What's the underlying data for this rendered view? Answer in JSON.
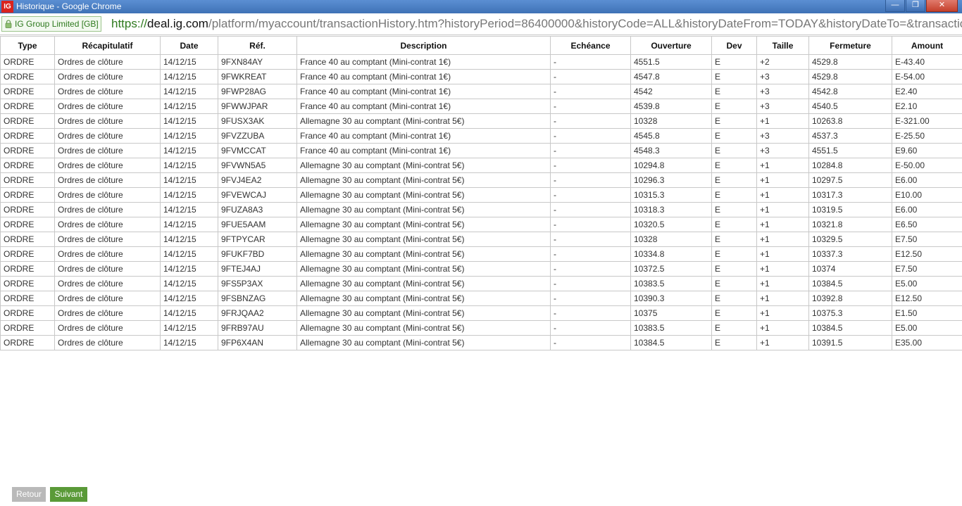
{
  "window": {
    "app_icon": "IG",
    "title": "Historique - Google Chrome"
  },
  "address": {
    "cert_label": "IG Group Limited [GB]",
    "scheme": "https://",
    "host": "deal.ig.com",
    "path": "/platform/myaccount/transactionHistory.htm?historyPeriod=86400000&historyCode=ALL&historyDateFrom=TODAY&historyDateTo=&transactionHisto"
  },
  "table": {
    "headers": [
      "Type",
      "Récapitulatif",
      "Date",
      "Réf.",
      "Description",
      "Echéance",
      "Ouverture",
      "Dev",
      "Taille",
      "Fermeture",
      "Amount"
    ],
    "rows": [
      [
        "ORDRE",
        "Ordres de clôture",
        "14/12/15",
        "9FXN84AY",
        "France 40 au comptant (Mini-contrat 1€)",
        "-",
        "4551.5",
        "E",
        "+2",
        "4529.8",
        "E-43.40"
      ],
      [
        "ORDRE",
        "Ordres de clôture",
        "14/12/15",
        "9FWKREAT",
        "France 40 au comptant (Mini-contrat 1€)",
        "-",
        "4547.8",
        "E",
        "+3",
        "4529.8",
        "E-54.00"
      ],
      [
        "ORDRE",
        "Ordres de clôture",
        "14/12/15",
        "9FWP28AG",
        "France 40 au comptant (Mini-contrat 1€)",
        "-",
        "4542",
        "E",
        "+3",
        "4542.8",
        "E2.40"
      ],
      [
        "ORDRE",
        "Ordres de clôture",
        "14/12/15",
        "9FWWJPAR",
        "France 40 au comptant (Mini-contrat 1€)",
        "-",
        "4539.8",
        "E",
        "+3",
        "4540.5",
        "E2.10"
      ],
      [
        "ORDRE",
        "Ordres de clôture",
        "14/12/15",
        "9FUSX3AK",
        "Allemagne 30 au comptant (Mini-contrat 5€)",
        "-",
        "10328",
        "E",
        "+1",
        "10263.8",
        "E-321.00"
      ],
      [
        "ORDRE",
        "Ordres de clôture",
        "14/12/15",
        "9FVZZUBA",
        "France 40 au comptant (Mini-contrat 1€)",
        "-",
        "4545.8",
        "E",
        "+3",
        "4537.3",
        "E-25.50"
      ],
      [
        "ORDRE",
        "Ordres de clôture",
        "14/12/15",
        "9FVMCCAT",
        "France 40 au comptant (Mini-contrat 1€)",
        "-",
        "4548.3",
        "E",
        "+3",
        "4551.5",
        "E9.60"
      ],
      [
        "ORDRE",
        "Ordres de clôture",
        "14/12/15",
        "9FVWN5A5",
        "Allemagne 30 au comptant (Mini-contrat 5€)",
        "-",
        "10294.8",
        "E",
        "+1",
        "10284.8",
        "E-50.00"
      ],
      [
        "ORDRE",
        "Ordres de clôture",
        "14/12/15",
        "9FVJ4EA2",
        "Allemagne 30 au comptant (Mini-contrat 5€)",
        "-",
        "10296.3",
        "E",
        "+1",
        "10297.5",
        "E6.00"
      ],
      [
        "ORDRE",
        "Ordres de clôture",
        "14/12/15",
        "9FVEWCAJ",
        "Allemagne 30 au comptant (Mini-contrat 5€)",
        "-",
        "10315.3",
        "E",
        "+1",
        "10317.3",
        "E10.00"
      ],
      [
        "ORDRE",
        "Ordres de clôture",
        "14/12/15",
        "9FUZA8A3",
        "Allemagne 30 au comptant (Mini-contrat 5€)",
        "-",
        "10318.3",
        "E",
        "+1",
        "10319.5",
        "E6.00"
      ],
      [
        "ORDRE",
        "Ordres de clôture",
        "14/12/15",
        "9FUE5AAM",
        "Allemagne 30 au comptant (Mini-contrat 5€)",
        "-",
        "10320.5",
        "E",
        "+1",
        "10321.8",
        "E6.50"
      ],
      [
        "ORDRE",
        "Ordres de clôture",
        "14/12/15",
        "9FTPYCAR",
        "Allemagne 30 au comptant (Mini-contrat 5€)",
        "-",
        "10328",
        "E",
        "+1",
        "10329.5",
        "E7.50"
      ],
      [
        "ORDRE",
        "Ordres de clôture",
        "14/12/15",
        "9FUKF7BD",
        "Allemagne 30 au comptant (Mini-contrat 5€)",
        "-",
        "10334.8",
        "E",
        "+1",
        "10337.3",
        "E12.50"
      ],
      [
        "ORDRE",
        "Ordres de clôture",
        "14/12/15",
        "9FTEJ4AJ",
        "Allemagne 30 au comptant (Mini-contrat 5€)",
        "-",
        "10372.5",
        "E",
        "+1",
        "10374",
        "E7.50"
      ],
      [
        "ORDRE",
        "Ordres de clôture",
        "14/12/15",
        "9FS5P3AX",
        "Allemagne 30 au comptant (Mini-contrat 5€)",
        "-",
        "10383.5",
        "E",
        "+1",
        "10384.5",
        "E5.00"
      ],
      [
        "ORDRE",
        "Ordres de clôture",
        "14/12/15",
        "9FSBNZAG",
        "Allemagne 30 au comptant (Mini-contrat 5€)",
        "-",
        "10390.3",
        "E",
        "+1",
        "10392.8",
        "E12.50"
      ],
      [
        "ORDRE",
        "Ordres de clôture",
        "14/12/15",
        "9FRJQAA2",
        "Allemagne 30 au comptant (Mini-contrat 5€)",
        "-",
        "10375",
        "E",
        "+1",
        "10375.3",
        "E1.50"
      ],
      [
        "ORDRE",
        "Ordres de clôture",
        "14/12/15",
        "9FRB97AU",
        "Allemagne 30 au comptant (Mini-contrat 5€)",
        "-",
        "10383.5",
        "E",
        "+1",
        "10384.5",
        "E5.00"
      ],
      [
        "ORDRE",
        "Ordres de clôture",
        "14/12/15",
        "9FP6X4AN",
        "Allemagne 30 au comptant (Mini-contrat 5€)",
        "-",
        "10384.5",
        "E",
        "+1",
        "10391.5",
        "E35.00"
      ]
    ]
  },
  "pagination": {
    "back_label": "Retour",
    "next_label": "Suivant"
  },
  "colors": {
    "titlebar": "#4a7ec0",
    "secure_green": "#2f7a1f",
    "next_button": "#5a9a38",
    "back_button": "#b9b9b9",
    "close_button": "#c5402c"
  }
}
